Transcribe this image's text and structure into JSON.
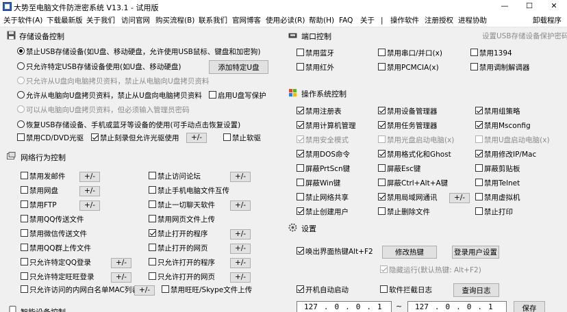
{
  "title": "大势至电脑文件防泄密系统 V13.1 - 试用版",
  "window_controls": {
    "minimize": "—",
    "maximize": "☐",
    "close": "✕"
  },
  "menu": {
    "items": [
      "关于软件(A)",
      "下载最新版",
      "关于我们",
      "访问官网",
      "购买流程(B)",
      "联系我们",
      "官网博客",
      "使用必读(R)",
      "帮助(H)",
      "FAQ",
      "关于",
      "|",
      "操作软件",
      "注册授权",
      "进程协助"
    ],
    "uninstall": "卸载程序"
  },
  "storage": {
    "title": "存储设备控制",
    "opt1": "禁止USB存储设备(如U盘、移动硬盘，允许使用USB鼠标、键盘和加密狗)",
    "opt2": "只允许特定USB存储设备使用(如U盘、移动硬盘)",
    "add_specific": "添加特定U盘",
    "opt2_sub": "只允许从U盘向电脑拷贝资料，禁止从电脑向U盘拷贝资料",
    "opt3": "允许从电脑向U盘拷贝资料，禁止从U盘向电脑拷贝资料",
    "write_protect": "启用U盘写保护",
    "opt3_sub": "可以从电脑向U盘拷贝资料，但必须输入管理员密码",
    "opt4": "恢复USB存储设备、手机或蓝牙等设备的使用(可手动点击恢复设置)",
    "cd": "禁用CD/DVD光驱",
    "burn": "禁止刻录但允许光驱使用",
    "burn_pm": "+/-",
    "floppy": "禁止软驱"
  },
  "network": {
    "title": "网络行为控制",
    "left": [
      {
        "label": "禁用发邮件",
        "pm": "+/-"
      },
      {
        "label": "禁用网盘",
        "pm": "+/-"
      },
      {
        "label": "禁用FTP",
        "pm": "+/-"
      },
      {
        "label": "禁用QQ传送文件",
        "pm": ""
      },
      {
        "label": "禁用微信传送文件",
        "pm": ""
      },
      {
        "label": "禁用QQ群上传文件",
        "pm": ""
      },
      {
        "label": "只允许特定QQ登录",
        "pm": "+/-"
      },
      {
        "label": "只允许特定旺旺登录",
        "pm": "+/-"
      }
    ],
    "right": [
      {
        "label": "禁止访问论坛",
        "pm": "+/-"
      },
      {
        "label": "禁止手机电脑文件互传",
        "pm": ""
      },
      {
        "label": "禁止一切聊天软件",
        "pm": "+/-"
      },
      {
        "label": "禁用网页文件上传",
        "pm": ""
      },
      {
        "label": "禁止打开的程序",
        "pm": "+/-"
      },
      {
        "label": "禁止打开的网页",
        "pm": "+/-"
      },
      {
        "label": "只允许打开的程序",
        "pm": "+/-"
      },
      {
        "label": "只允许打开的网页",
        "pm": "+/-"
      }
    ],
    "mac_label": "只允许访问的内网白名单MAC列表",
    "mac_pm": "+/-",
    "wangwang": "禁用旺旺/Skype文件上传"
  },
  "smart_title": "智能设备控制",
  "port": {
    "title": "端口控制",
    "hint": "设置USB存储设备保护密码",
    "items": [
      "禁用蓝牙",
      "禁用串口/并口(x)",
      "禁用1394",
      "禁用红外",
      "禁用PCMCIA(x)",
      "禁用调制解调器"
    ]
  },
  "os": {
    "title": "操作系统控制",
    "items": [
      {
        "label": "禁用注册表",
        "checked": true,
        "disabled": false
      },
      {
        "label": "禁用设备管理器",
        "checked": true,
        "disabled": false
      },
      {
        "label": "禁用组策略",
        "checked": true,
        "disabled": false
      },
      {
        "label": "禁用计算机管理",
        "checked": true,
        "disabled": false
      },
      {
        "label": "禁用任务管理器",
        "checked": true,
        "disabled": false
      },
      {
        "label": "禁用Msconfig",
        "checked": true,
        "disabled": false
      },
      {
        "label": "禁用安全模式",
        "checked": true,
        "disabled": true
      },
      {
        "label": "禁用光盘启动电脑(x)",
        "checked": false,
        "disabled": true
      },
      {
        "label": "禁用U盘启动电脑(x)",
        "checked": false,
        "disabled": true
      },
      {
        "label": "禁用DOS命令",
        "checked": true,
        "disabled": false
      },
      {
        "label": "禁用格式化和Ghost",
        "checked": true,
        "disabled": false
      },
      {
        "label": "禁用修改IP/Mac",
        "checked": true,
        "disabled": false
      },
      {
        "label": "屏蔽PrtScn键",
        "checked": false,
        "disabled": false
      },
      {
        "label": "屏蔽Esc键",
        "checked": false,
        "disabled": false
      },
      {
        "label": "屏蔽剪贴板",
        "checked": false,
        "disabled": false
      },
      {
        "label": "屏蔽Win键",
        "checked": false,
        "disabled": false
      },
      {
        "label": "屏蔽Ctrl+Alt+A键",
        "checked": false,
        "disabled": false
      },
      {
        "label": "禁用Telnet",
        "checked": false,
        "disabled": false
      },
      {
        "label": "禁止网络共享",
        "checked": false,
        "disabled": false
      },
      {
        "label": "禁用局域网通讯",
        "checked": true,
        "disabled": false
      },
      {
        "label": "禁用虚拟机",
        "checked": false,
        "disabled": false
      },
      {
        "label": "禁止创建用户",
        "checked": true,
        "disabled": false
      },
      {
        "label": "禁止删除文件",
        "checked": false,
        "disabled": false
      },
      {
        "label": "禁止打印",
        "checked": false,
        "disabled": false
      }
    ],
    "lan_pm": "+/-"
  },
  "settings": {
    "title": "设置",
    "hotkey": "唤出界面热键Alt+F2",
    "modify_hotkey": "修改热键",
    "login_user": "登录用户设置",
    "hidden_run": "隐藏运行(默认热键: Alt+F2)",
    "autostart": "开机自动启动",
    "intercept_log": "软件拦截日志",
    "view_log": "查询日志",
    "ip_from": [
      "127",
      "0",
      "0",
      "1"
    ],
    "ip_to": [
      "127",
      "0",
      "0",
      "1"
    ],
    "ip_sep": "~",
    "save": "保存"
  }
}
